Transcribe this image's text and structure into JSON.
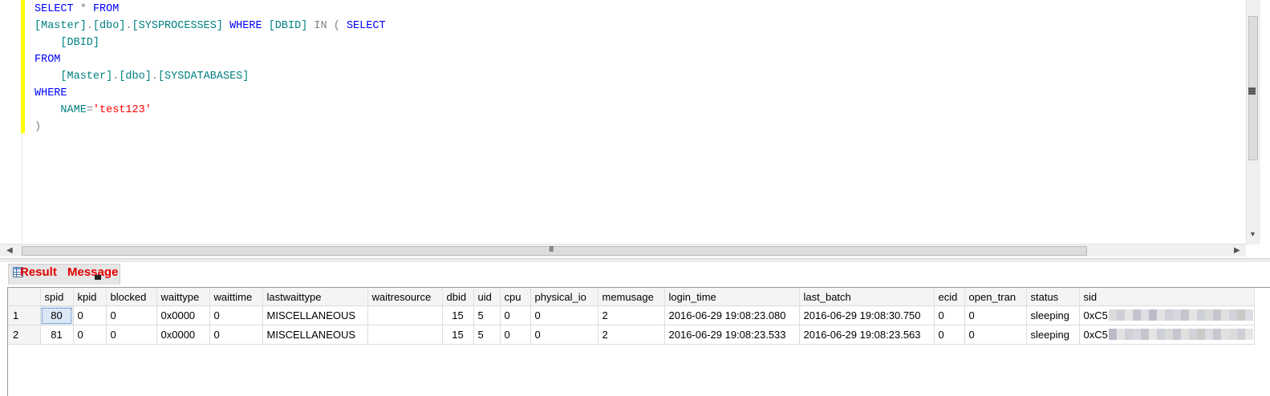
{
  "query": {
    "lines": [
      [
        {
          "t": "SELECT",
          "c": "kw"
        },
        {
          "t": " ",
          "c": "tx"
        },
        {
          "t": "*",
          "c": "gr"
        },
        {
          "t": " ",
          "c": "tx"
        },
        {
          "t": "FROM",
          "c": "kw"
        }
      ],
      [
        {
          "t": "[Master]",
          "c": "ob"
        },
        {
          "t": ".",
          "c": "gr"
        },
        {
          "t": "[dbo]",
          "c": "ob"
        },
        {
          "t": ".",
          "c": "gr"
        },
        {
          "t": "[SYSPROCESSES]",
          "c": "ob"
        },
        {
          "t": " ",
          "c": "tx"
        },
        {
          "t": "WHERE",
          "c": "kw"
        },
        {
          "t": " ",
          "c": "tx"
        },
        {
          "t": "[DBID]",
          "c": "ob"
        },
        {
          "t": " ",
          "c": "tx"
        },
        {
          "t": "IN",
          "c": "gr"
        },
        {
          "t": " ",
          "c": "tx"
        },
        {
          "t": "(",
          "c": "gr"
        },
        {
          "t": " ",
          "c": "tx"
        },
        {
          "t": "SELECT",
          "c": "kw"
        }
      ],
      [
        {
          "t": "    ",
          "c": "tx"
        },
        {
          "t": "[DBID]",
          "c": "ob"
        }
      ],
      [
        {
          "t": "FROM",
          "c": "kw"
        }
      ],
      [
        {
          "t": "    ",
          "c": "tx"
        },
        {
          "t": "[Master]",
          "c": "ob"
        },
        {
          "t": ".",
          "c": "gr"
        },
        {
          "t": "[dbo]",
          "c": "ob"
        },
        {
          "t": ".",
          "c": "gr"
        },
        {
          "t": "[SYSDATABASES]",
          "c": "ob"
        }
      ],
      [
        {
          "t": "WHERE",
          "c": "kw"
        }
      ],
      [
        {
          "t": "    ",
          "c": "tx"
        },
        {
          "t": "NAME",
          "c": "ob"
        },
        {
          "t": "=",
          "c": "gr"
        },
        {
          "t": "'test123'",
          "c": "str"
        }
      ],
      [
        {
          "t": ")",
          "c": "gr"
        }
      ]
    ]
  },
  "scrollbar": {
    "grip": "III"
  },
  "tabs": {
    "result_label": "Result",
    "message_label": "Message"
  },
  "grid": {
    "columns": [
      "",
      "spid",
      "kpid",
      "blocked",
      "waittype",
      "waittime",
      "lastwaittype",
      "waitresource",
      "dbid",
      "uid",
      "cpu",
      "physical_io",
      "memusage",
      "login_time",
      "last_batch",
      "ecid",
      "open_tran",
      "status",
      "sid"
    ],
    "rows": [
      [
        "1",
        "80",
        "0",
        "0",
        "0x0000",
        "0",
        "MISCELLANEOUS",
        "",
        "15",
        "5",
        "0",
        "0",
        "2",
        "2016-06-29 19:08:23.080",
        "2016-06-29 19:08:30.750",
        "0",
        "0",
        "sleeping",
        "0xC5"
      ],
      [
        "2",
        "81",
        "0",
        "0",
        "0x0000",
        "0",
        "MISCELLANEOUS",
        "",
        "15",
        "5",
        "0",
        "0",
        "2",
        "2016-06-29 19:08:23.533",
        "2016-06-29 19:08:23.563",
        "0",
        "0",
        "sleeping",
        "0xC5"
      ]
    ],
    "selected_cell": {
      "row": 0,
      "column": 1
    }
  },
  "colors": {
    "keyword": "#0000ff",
    "object": "#008080",
    "operator": "#808080",
    "string": "#ff0000",
    "tab_label": "#e30000",
    "change_bar": "#ffff00"
  }
}
